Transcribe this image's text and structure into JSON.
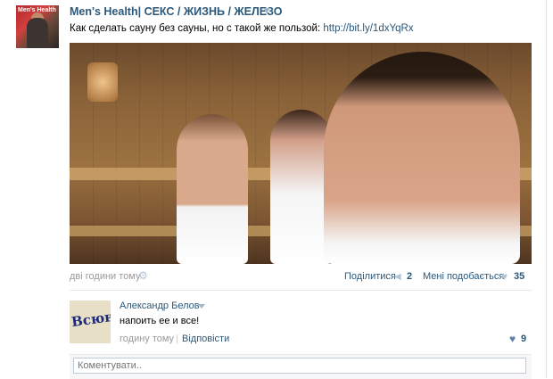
{
  "post": {
    "page_name": "Men's Health| СЕКС / ЖИЗНЬ / ЖЕЛЕЗО",
    "text": "Как сделать сауну без сауны, но с такой же пользой: ",
    "link": "http://bit.ly/1dxYqRx",
    "time": "дві години тому",
    "share_label": "Поділитися",
    "share_count": "2",
    "like_label": "Мені подобається",
    "like_count": "35",
    "avatar_text": "Men's Health"
  },
  "comment": {
    "author": "Александр Белов",
    "text": "напоить ее и все!",
    "time": "годину тому",
    "separator": "|",
    "reply_label": "Відповісти",
    "likes": "9",
    "avatar_text": "Всюн"
  },
  "comment_box": {
    "placeholder": "Коментувати.."
  },
  "colors": {
    "link": "#2b587a",
    "muted": "#999999",
    "icon": "#b8c4d2"
  },
  "icons": {
    "gear": "⚙",
    "megaphone": "📢",
    "heart": "♥"
  }
}
